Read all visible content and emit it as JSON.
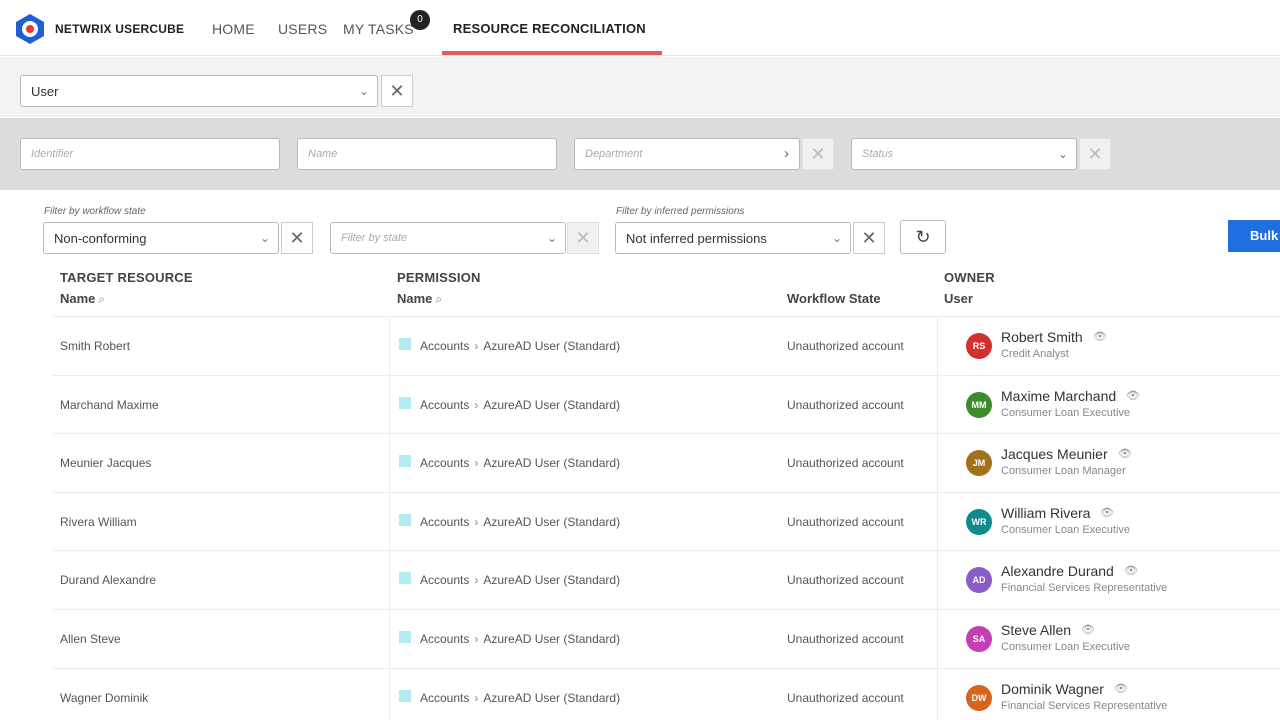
{
  "app": {
    "brand": "NETWRIX USERCUBE"
  },
  "nav": {
    "home": "HOME",
    "users": "USERS",
    "my_tasks": "MY TASKS",
    "my_tasks_badge": "0",
    "resource_reconciliation": "RESOURCE RECONCILIATION"
  },
  "entity_select": {
    "value": "User"
  },
  "filters": {
    "identifier_placeholder": "Identifier",
    "name_placeholder": "Name",
    "department_placeholder": "Department",
    "status_placeholder": "Status"
  },
  "panel": {
    "workflow_label": "Filter by workflow state",
    "workflow_value": "Non-conforming",
    "state_placeholder": "Filter by state",
    "inferred_label": "Filter by inferred permissions",
    "inferred_value": "Not inferred permissions",
    "bulk_label": "Bulk"
  },
  "table": {
    "headers": {
      "target_resource": "TARGET RESOURCE",
      "target_name": "Name",
      "permission": "PERMISSION",
      "permission_name": "Name",
      "workflow_state": "Workflow State",
      "owner": "OWNER",
      "owner_user": "User"
    },
    "rows": [
      {
        "target": "Smith Robert",
        "perm_root": "Accounts",
        "perm_leaf": "AzureAD User (Standard)",
        "state": "Unauthorized account",
        "initials": "RS",
        "owner": "Robert Smith",
        "title": "Credit Analyst",
        "color": "#d32f2f"
      },
      {
        "target": "Marchand Maxime",
        "perm_root": "Accounts",
        "perm_leaf": "AzureAD User (Standard)",
        "state": "Unauthorized account",
        "initials": "MM",
        "owner": "Maxime Marchand",
        "title": "Consumer Loan Executive",
        "color": "#3d8b2d"
      },
      {
        "target": "Meunier Jacques",
        "perm_root": "Accounts",
        "perm_leaf": "AzureAD User (Standard)",
        "state": "Unauthorized account",
        "initials": "JM",
        "owner": "Jacques Meunier",
        "title": "Consumer Loan Manager",
        "color": "#a0721a"
      },
      {
        "target": "Rivera William",
        "perm_root": "Accounts",
        "perm_leaf": "AzureAD User (Standard)",
        "state": "Unauthorized account",
        "initials": "WR",
        "owner": "William Rivera",
        "title": "Consumer Loan Executive",
        "color": "#0f8a8f"
      },
      {
        "target": "Durand Alexandre",
        "perm_root": "Accounts",
        "perm_leaf": "AzureAD User (Standard)",
        "state": "Unauthorized account",
        "initials": "AD",
        "owner": "Alexandre Durand",
        "title": "Financial Services Representative",
        "color": "#8a5cc7"
      },
      {
        "target": "Allen Steve",
        "perm_root": "Accounts",
        "perm_leaf": "AzureAD User (Standard)",
        "state": "Unauthorized account",
        "initials": "SA",
        "owner": "Steve Allen",
        "title": "Consumer Loan Executive",
        "color": "#c43fb6"
      },
      {
        "target": "Wagner Dominik",
        "perm_root": "Accounts",
        "perm_leaf": "AzureAD User (Standard)",
        "state": "Unauthorized account",
        "initials": "DW",
        "owner": "Dominik Wagner",
        "title": "Financial Services Representative",
        "color": "#d9621c"
      }
    ]
  }
}
